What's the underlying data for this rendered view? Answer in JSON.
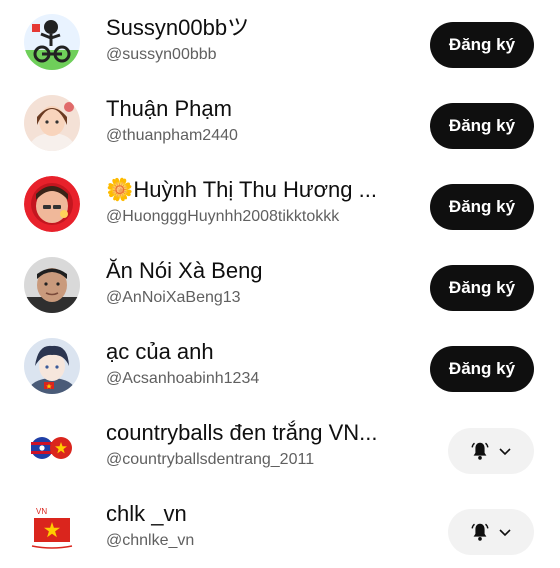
{
  "subscribe_label": "Đăng ký",
  "channels": [
    {
      "name": "Sussyn00bbツ",
      "handle": "@sussyn00bbb",
      "button": "subscribe",
      "avatar_icon": "stickman-bike-avatar"
    },
    {
      "name": "Thuận Phạm",
      "handle": "@thuanpham2440",
      "button": "subscribe",
      "avatar_icon": "girl-photo-avatar"
    },
    {
      "name": "🌼Huỳnh Thị Thu Hương ...",
      "handle": "@HuongggHuynhh2008tikktokkk",
      "button": "subscribe",
      "avatar_icon": "red-frame-avatar"
    },
    {
      "name": "Ăn Nói Xà Beng",
      "handle": "@AnNoiXaBeng13",
      "button": "subscribe",
      "avatar_icon": "man-photo-avatar"
    },
    {
      "name": "ạc của anh",
      "handle": "@Acsanhoabinh1234",
      "button": "subscribe",
      "avatar_icon": "anime-boy-avatar"
    },
    {
      "name": "countryballs đen trắng VN...",
      "handle": "@countryballsdentrang_2011",
      "button": "notifications",
      "avatar_icon": "countryballs-avatar"
    },
    {
      "name": "chlk _vn",
      "handle": "@chnlke_vn",
      "button": "notifications",
      "avatar_icon": "vietnam-flag-avatar"
    }
  ],
  "colors": {
    "subscribe_bg": "#0f0f0f",
    "bell_bg": "#f2f2f2",
    "handle_text": "#606060"
  }
}
